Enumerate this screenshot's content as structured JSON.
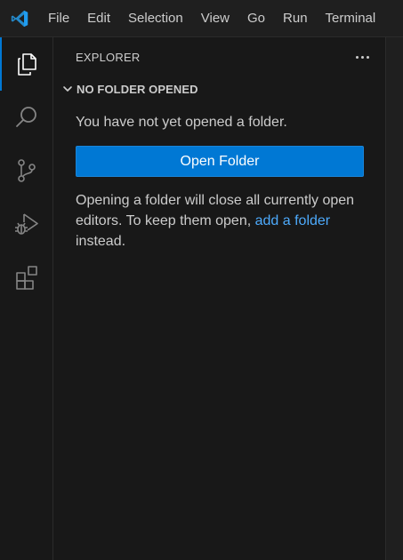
{
  "app": {
    "logo_icon": "vscode-logo-icon",
    "accent_color": "#0078d4"
  },
  "menu": {
    "items": [
      {
        "label": "File"
      },
      {
        "label": "Edit"
      },
      {
        "label": "Selection"
      },
      {
        "label": "View"
      },
      {
        "label": "Go"
      },
      {
        "label": "Run"
      },
      {
        "label": "Terminal"
      }
    ]
  },
  "activity_bar": {
    "items": [
      {
        "icon": "explorer-icon",
        "active": true
      },
      {
        "icon": "search-icon",
        "active": false
      },
      {
        "icon": "source-control-icon",
        "active": false
      },
      {
        "icon": "run-debug-icon",
        "active": false
      },
      {
        "icon": "extensions-icon",
        "active": false
      }
    ]
  },
  "sidebar": {
    "title": "EXPLORER",
    "more_actions_icon": "more-actions-icon",
    "section": {
      "title": "NO FOLDER OPENED",
      "expanded": true
    },
    "welcome": {
      "message": "You have not yet opened a folder.",
      "button_label": "Open Folder",
      "note_before": "Opening a folder will close all currently open editors. To keep them open, ",
      "note_link": "add a folder",
      "note_after": " instead."
    }
  }
}
